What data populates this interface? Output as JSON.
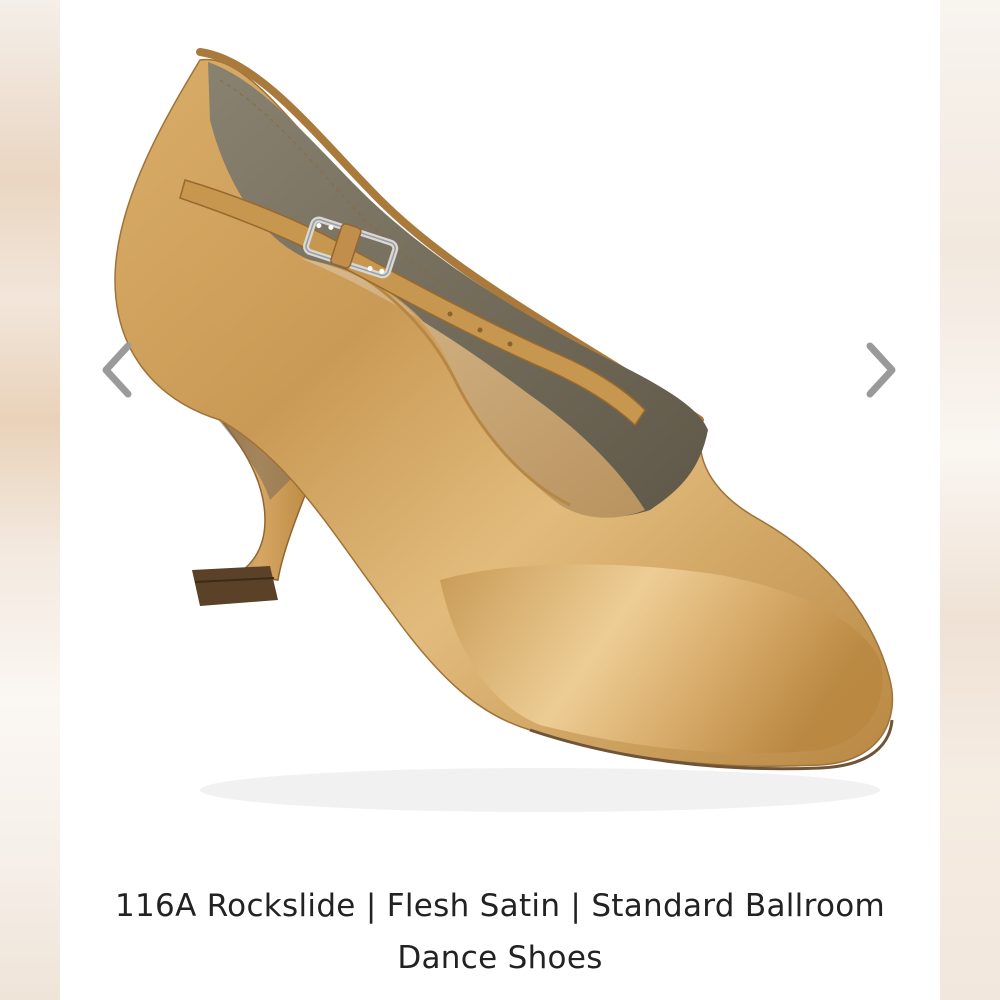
{
  "product": {
    "title": "116A Rockslide | Flesh Satin | Standard Ballroom Dance Shoes",
    "image_alt": "Flesh satin ballroom shoe with buckle strap"
  },
  "carousel": {
    "prev_icon": "chevron-left-icon",
    "next_icon": "chevron-right-icon"
  },
  "colors": {
    "satin_base": "#c99a55",
    "satin_highlight": "#f0cf94",
    "satin_shadow": "#8f6530",
    "lining": "#7d7563",
    "arrow": "#9a9a9a"
  }
}
